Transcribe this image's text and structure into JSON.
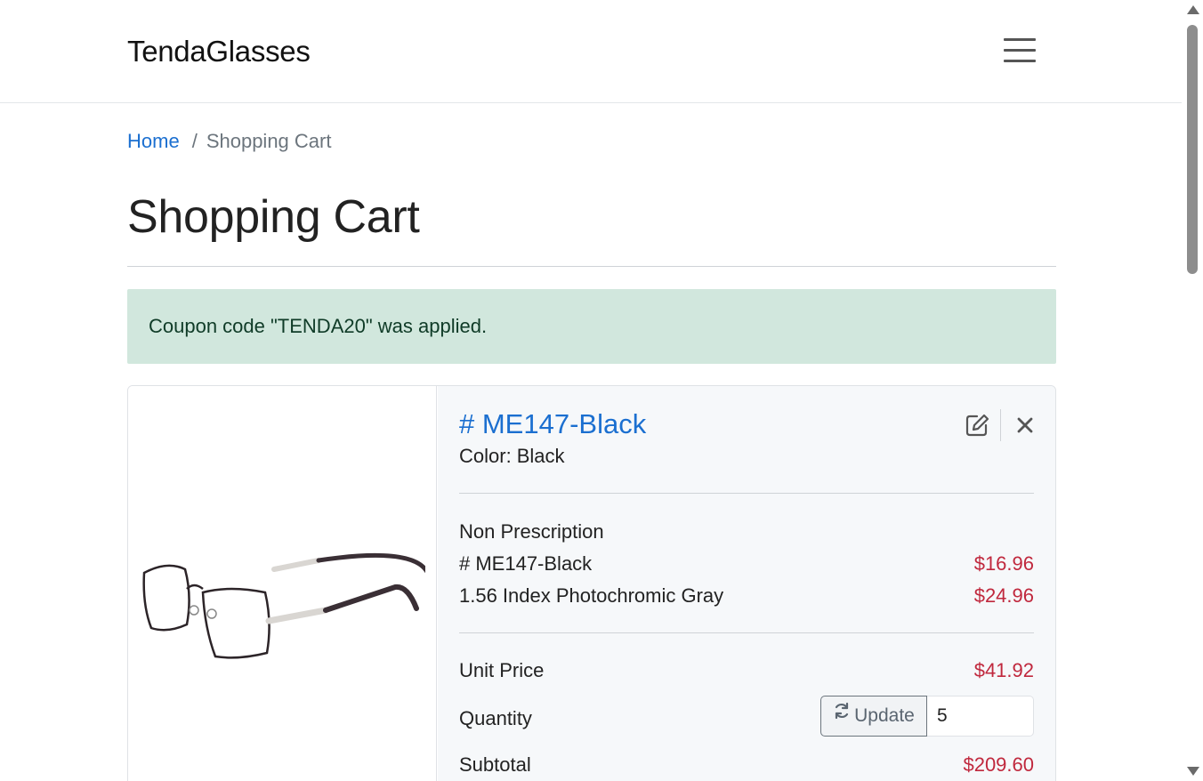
{
  "header": {
    "brand": "TendaGlasses",
    "menu_icon": "hamburger-menu-icon"
  },
  "breadcrumb": {
    "home": "Home",
    "separator": "/",
    "current": "Shopping Cart"
  },
  "page_title": "Shopping Cart",
  "alert": {
    "message": "Coupon code \"TENDA20\" was applied."
  },
  "cart_item": {
    "image_alt": "eyeglasses-frame",
    "title": "# ME147-Black",
    "color_label": "Color:",
    "color_value": "Black",
    "edit_icon": "edit-icon",
    "remove_icon": "close-icon",
    "prescription": "Non Prescription",
    "lines": [
      {
        "label": "# ME147-Black",
        "price": "$16.96"
      },
      {
        "label": "1.56 Index Photochromic Gray",
        "price": "$24.96"
      }
    ],
    "unit_price_label": "Unit Price",
    "unit_price": "$41.92",
    "quantity_label": "Quantity",
    "update_label": "Update",
    "update_icon": "refresh-icon",
    "quantity_value": "5",
    "subtotal_label": "Subtotal",
    "subtotal": "$209.60"
  },
  "colors": {
    "link": "#1b6fd0",
    "price": "#c0283d",
    "alert_bg": "#d1e7dd",
    "alert_text": "#0f3b27"
  }
}
